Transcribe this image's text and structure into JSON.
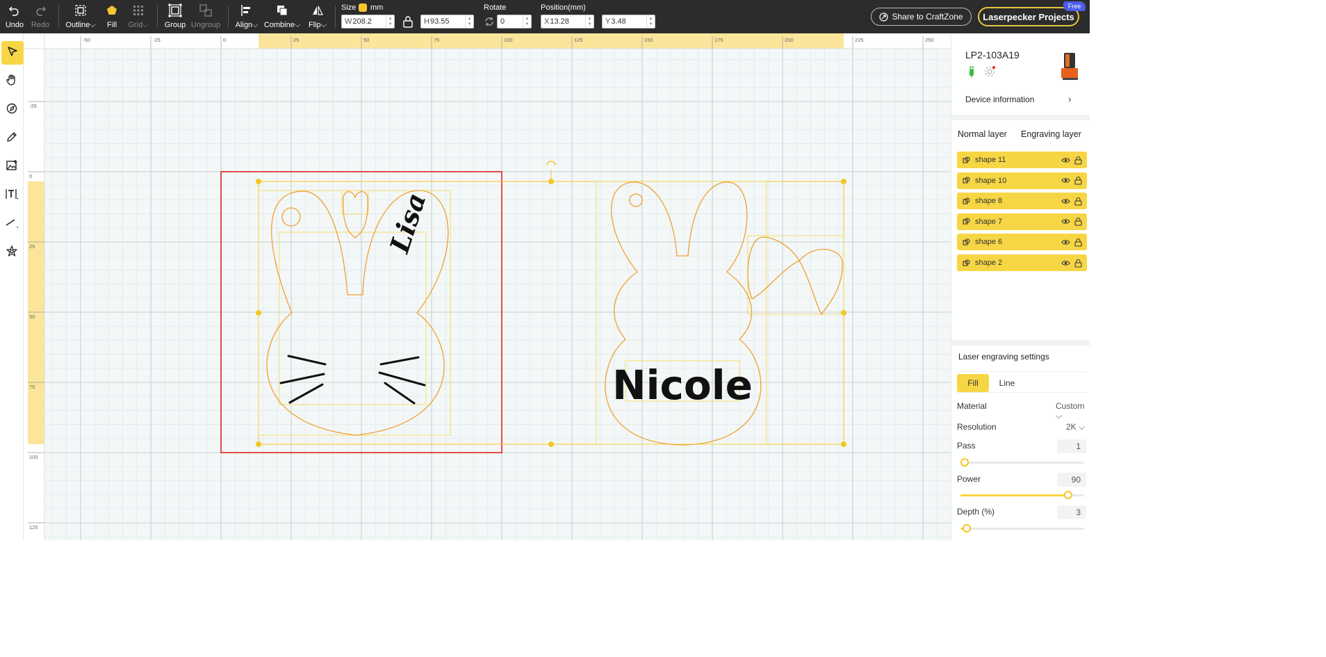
{
  "toolbar": {
    "undo": "Undo",
    "redo": "Redo",
    "outline": "Outline",
    "fill": "Fill",
    "grid": "Grid",
    "group": "Group",
    "ungroup": "Ungroup",
    "align": "Align",
    "combine": "Combine",
    "flip": "Flip",
    "size_label": "Size",
    "size_unit": "mm",
    "width_prefix": "W",
    "width_value": "208.2",
    "height_prefix": "H",
    "height_value": "93.55",
    "rotate_label": "Rotate",
    "rotate_value": "0",
    "position_label": "Position(mm)",
    "x_prefix": "X",
    "x_value": "13.28",
    "y_prefix": "Y",
    "y_value": "3.48",
    "share_label": "Share to CraftZone",
    "projects_label": "Laserpecker Projects",
    "free_badge": "Free"
  },
  "left_tools": [
    "select-icon",
    "hand-icon",
    "pen-icon",
    "pencil-icon",
    "image-icon",
    "text-icon",
    "line-icon",
    "shape-icon"
  ],
  "ruler": {
    "h_labels": [
      "-50",
      "-25",
      "0",
      "25",
      "50",
      "75",
      "100",
      "125",
      "150",
      "175",
      "200",
      "225",
      "250"
    ],
    "v_labels": [
      "-25",
      "0",
      "25",
      "50",
      "75",
      "100",
      "125"
    ]
  },
  "canvas_text": {
    "lisa": "Lisa",
    "nicole": "Nicole"
  },
  "device": {
    "name": "LP2-103A19",
    "info_label": "Device information"
  },
  "tabs": {
    "normal": "Normal layer",
    "engraving": "Engraving layer"
  },
  "layers": [
    "shape 11",
    "shape 10",
    "shape 8",
    "shape 7",
    "shape 6",
    "shape 2"
  ],
  "settings": {
    "title": "Laser engraving settings",
    "mode_fill": "Fill",
    "mode_line": "Line",
    "material_label": "Material",
    "material_value": "Custom",
    "resolution_label": "Resolution",
    "resolution_value": "2K",
    "pass_label": "Pass",
    "pass_value": "1",
    "pass_fraction": 0.0,
    "power_label": "Power",
    "power_value": "90",
    "power_fraction": 0.9,
    "depth_label": "Depth (%)",
    "depth_value": "3",
    "depth_fraction": 0.02
  },
  "colors": {
    "accent": "#f7d645",
    "shape_stroke": "#f0a030",
    "selection_red": "#e02020",
    "toolbar_bg": "#2c2c2c"
  }
}
